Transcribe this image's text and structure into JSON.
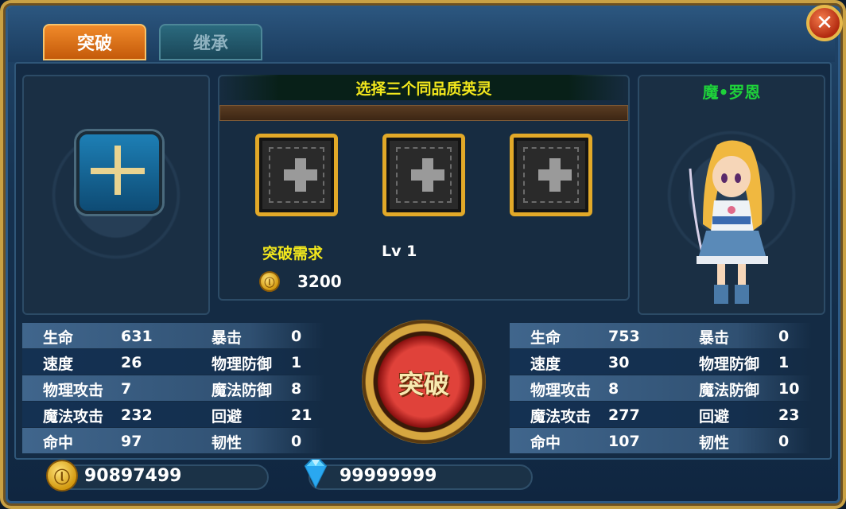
{
  "tabs": [
    {
      "label": "突破",
      "active": true
    },
    {
      "label": "继承",
      "active": false
    }
  ],
  "close_icon": "close-icon",
  "selection": {
    "title": "选择三个同品质英灵",
    "slots": [
      "add-slot-1",
      "add-slot-2",
      "add-slot-3"
    ]
  },
  "requirement": {
    "label": "突破需求",
    "level": "Lv 1",
    "cost": "3200"
  },
  "hero": {
    "name": "魔•罗恩"
  },
  "stats_left": [
    {
      "n1": "生命",
      "v1": "631",
      "n2": "暴击",
      "v2": "0"
    },
    {
      "n1": "速度",
      "v1": "26",
      "n2": "物理防御",
      "v2": "1"
    },
    {
      "n1": "物理攻击",
      "v1": "7",
      "n2": "魔法防御",
      "v2": "8"
    },
    {
      "n1": "魔法攻击",
      "v1": "232",
      "n2": "回避",
      "v2": "21"
    },
    {
      "n1": "命中",
      "v1": "97",
      "n2": "韧性",
      "v2": "0"
    }
  ],
  "stats_right": [
    {
      "n1": "生命",
      "v1": "753",
      "n2": "暴击",
      "v2": "0"
    },
    {
      "n1": "速度",
      "v1": "30",
      "n2": "物理防御",
      "v2": "1"
    },
    {
      "n1": "物理攻击",
      "v1": "8",
      "n2": "魔法防御",
      "v2": "10"
    },
    {
      "n1": "魔法攻击",
      "v1": "277",
      "n2": "回避",
      "v2": "23"
    },
    {
      "n1": "命中",
      "v1": "107",
      "n2": "韧性",
      "v2": "0"
    }
  ],
  "break_button": {
    "label": "突破"
  },
  "currency": {
    "gold": "90897499",
    "gems": "99999999"
  },
  "colors": {
    "accent_gold": "#e2a928",
    "title_yellow": "#f3e81c",
    "hero_name_green": "#1ed33a",
    "active_tab": "#e07a1a"
  }
}
